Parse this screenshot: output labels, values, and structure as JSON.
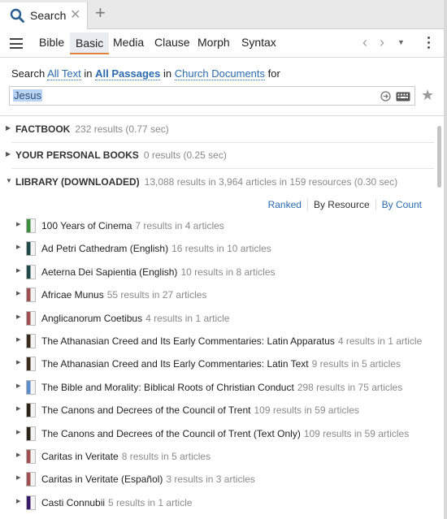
{
  "tab": {
    "label": "Search",
    "close": "✕",
    "new_tab": "+",
    "search_icon": "search-icon"
  },
  "toolbar": {
    "tabs": [
      "Bible",
      "Basic",
      "Media",
      "Clause",
      "Morph",
      "Syntax"
    ],
    "active_tab": "Basic",
    "back": "‹",
    "forward": "›",
    "history_caret": "▼"
  },
  "search": {
    "prefix": "Search",
    "field": "All Text",
    "in1": "in",
    "scope": "All Passages",
    "in2": "in",
    "collection": "Church Documents",
    "for": "for",
    "query": "Jesus"
  },
  "groups": {
    "factbook": {
      "name": "FACTBOOK",
      "count": "232 results (0.77 sec)"
    },
    "personal": {
      "name": "YOUR PERSONAL BOOKS",
      "count": "0 results (0.25 sec)"
    },
    "library": {
      "name": "LIBRARY (DOWNLOADED)",
      "count": "13,088 results in 3,964 articles in 159 resources (0.30 sec)"
    }
  },
  "sort": {
    "ranked": "Ranked",
    "by_resource": "By Resource",
    "by_count": "By Count"
  },
  "results": [
    {
      "title": "100 Years of Cinema",
      "count": "7 results in 4 articles",
      "cover": "#3b8e3b"
    },
    {
      "title": "Ad Petri Cathedram (English)",
      "count": "16 results in 10 articles",
      "cover": "#1f4a48"
    },
    {
      "title": "Aeterna Dei Sapientia (English)",
      "count": "10 results in 8 articles",
      "cover": "#1f4a48"
    },
    {
      "title": "Africae Munus",
      "count": "55 results in 27 articles",
      "cover": "#a05050"
    },
    {
      "title": "Anglicanorum Coetibus",
      "count": "4 results in 1 article",
      "cover": "#a05050"
    },
    {
      "title": "The Athanasian Creed and Its Early Commentaries: Latin Apparatus",
      "count": "4 results in 1 article",
      "cover": "#3a2a1c"
    },
    {
      "title": "The Athanasian Creed and Its Early Commentaries: Latin Text",
      "count": "9 results in 5 articles",
      "cover": "#3a2a1c"
    },
    {
      "title": "The Bible and Morality: Biblical Roots of Christian Conduct",
      "count": "298 results in 75 articles",
      "cover": "#5b8dc9"
    },
    {
      "title": "The Canons and Decrees of the Council of Trent",
      "count": "109 results in 59 articles",
      "cover": "#2c2418"
    },
    {
      "title": "The Canons and Decrees of the Council of Trent (Text Only)",
      "count": "109 results in 59 articles",
      "cover": "#2c2418"
    },
    {
      "title": "Caritas in Veritate",
      "count": "8 results in 5 articles",
      "cover": "#a05050"
    },
    {
      "title": "Caritas in Veritate (Español)",
      "count": "3 results in 3 articles",
      "cover": "#a05050"
    },
    {
      "title": "Casti Connubii",
      "count": "5 results in 1 article",
      "cover": "#3a1a6a"
    }
  ],
  "colors": {
    "accent_orange": "#e0833a",
    "link_blue": "#2b6cb0",
    "selection": "#b9d3f3"
  }
}
